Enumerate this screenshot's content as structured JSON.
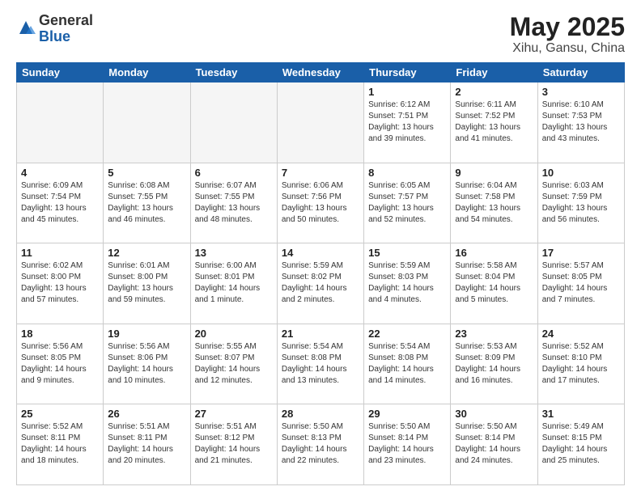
{
  "header": {
    "logo_general": "General",
    "logo_blue": "Blue",
    "month_year": "May 2025",
    "location": "Xihu, Gansu, China"
  },
  "weekdays": [
    "Sunday",
    "Monday",
    "Tuesday",
    "Wednesday",
    "Thursday",
    "Friday",
    "Saturday"
  ],
  "weeks": [
    [
      {
        "day": "",
        "info": ""
      },
      {
        "day": "",
        "info": ""
      },
      {
        "day": "",
        "info": ""
      },
      {
        "day": "",
        "info": ""
      },
      {
        "day": "1",
        "info": "Sunrise: 6:12 AM\nSunset: 7:51 PM\nDaylight: 13 hours\nand 39 minutes."
      },
      {
        "day": "2",
        "info": "Sunrise: 6:11 AM\nSunset: 7:52 PM\nDaylight: 13 hours\nand 41 minutes."
      },
      {
        "day": "3",
        "info": "Sunrise: 6:10 AM\nSunset: 7:53 PM\nDaylight: 13 hours\nand 43 minutes."
      }
    ],
    [
      {
        "day": "4",
        "info": "Sunrise: 6:09 AM\nSunset: 7:54 PM\nDaylight: 13 hours\nand 45 minutes."
      },
      {
        "day": "5",
        "info": "Sunrise: 6:08 AM\nSunset: 7:55 PM\nDaylight: 13 hours\nand 46 minutes."
      },
      {
        "day": "6",
        "info": "Sunrise: 6:07 AM\nSunset: 7:55 PM\nDaylight: 13 hours\nand 48 minutes."
      },
      {
        "day": "7",
        "info": "Sunrise: 6:06 AM\nSunset: 7:56 PM\nDaylight: 13 hours\nand 50 minutes."
      },
      {
        "day": "8",
        "info": "Sunrise: 6:05 AM\nSunset: 7:57 PM\nDaylight: 13 hours\nand 52 minutes."
      },
      {
        "day": "9",
        "info": "Sunrise: 6:04 AM\nSunset: 7:58 PM\nDaylight: 13 hours\nand 54 minutes."
      },
      {
        "day": "10",
        "info": "Sunrise: 6:03 AM\nSunset: 7:59 PM\nDaylight: 13 hours\nand 56 minutes."
      }
    ],
    [
      {
        "day": "11",
        "info": "Sunrise: 6:02 AM\nSunset: 8:00 PM\nDaylight: 13 hours\nand 57 minutes."
      },
      {
        "day": "12",
        "info": "Sunrise: 6:01 AM\nSunset: 8:00 PM\nDaylight: 13 hours\nand 59 minutes."
      },
      {
        "day": "13",
        "info": "Sunrise: 6:00 AM\nSunset: 8:01 PM\nDaylight: 14 hours\nand 1 minute."
      },
      {
        "day": "14",
        "info": "Sunrise: 5:59 AM\nSunset: 8:02 PM\nDaylight: 14 hours\nand 2 minutes."
      },
      {
        "day": "15",
        "info": "Sunrise: 5:59 AM\nSunset: 8:03 PM\nDaylight: 14 hours\nand 4 minutes."
      },
      {
        "day": "16",
        "info": "Sunrise: 5:58 AM\nSunset: 8:04 PM\nDaylight: 14 hours\nand 5 minutes."
      },
      {
        "day": "17",
        "info": "Sunrise: 5:57 AM\nSunset: 8:05 PM\nDaylight: 14 hours\nand 7 minutes."
      }
    ],
    [
      {
        "day": "18",
        "info": "Sunrise: 5:56 AM\nSunset: 8:05 PM\nDaylight: 14 hours\nand 9 minutes."
      },
      {
        "day": "19",
        "info": "Sunrise: 5:56 AM\nSunset: 8:06 PM\nDaylight: 14 hours\nand 10 minutes."
      },
      {
        "day": "20",
        "info": "Sunrise: 5:55 AM\nSunset: 8:07 PM\nDaylight: 14 hours\nand 12 minutes."
      },
      {
        "day": "21",
        "info": "Sunrise: 5:54 AM\nSunset: 8:08 PM\nDaylight: 14 hours\nand 13 minutes."
      },
      {
        "day": "22",
        "info": "Sunrise: 5:54 AM\nSunset: 8:08 PM\nDaylight: 14 hours\nand 14 minutes."
      },
      {
        "day": "23",
        "info": "Sunrise: 5:53 AM\nSunset: 8:09 PM\nDaylight: 14 hours\nand 16 minutes."
      },
      {
        "day": "24",
        "info": "Sunrise: 5:52 AM\nSunset: 8:10 PM\nDaylight: 14 hours\nand 17 minutes."
      }
    ],
    [
      {
        "day": "25",
        "info": "Sunrise: 5:52 AM\nSunset: 8:11 PM\nDaylight: 14 hours\nand 18 minutes."
      },
      {
        "day": "26",
        "info": "Sunrise: 5:51 AM\nSunset: 8:11 PM\nDaylight: 14 hours\nand 20 minutes."
      },
      {
        "day": "27",
        "info": "Sunrise: 5:51 AM\nSunset: 8:12 PM\nDaylight: 14 hours\nand 21 minutes."
      },
      {
        "day": "28",
        "info": "Sunrise: 5:50 AM\nSunset: 8:13 PM\nDaylight: 14 hours\nand 22 minutes."
      },
      {
        "day": "29",
        "info": "Sunrise: 5:50 AM\nSunset: 8:14 PM\nDaylight: 14 hours\nand 23 minutes."
      },
      {
        "day": "30",
        "info": "Sunrise: 5:50 AM\nSunset: 8:14 PM\nDaylight: 14 hours\nand 24 minutes."
      },
      {
        "day": "31",
        "info": "Sunrise: 5:49 AM\nSunset: 8:15 PM\nDaylight: 14 hours\nand 25 minutes."
      }
    ]
  ]
}
